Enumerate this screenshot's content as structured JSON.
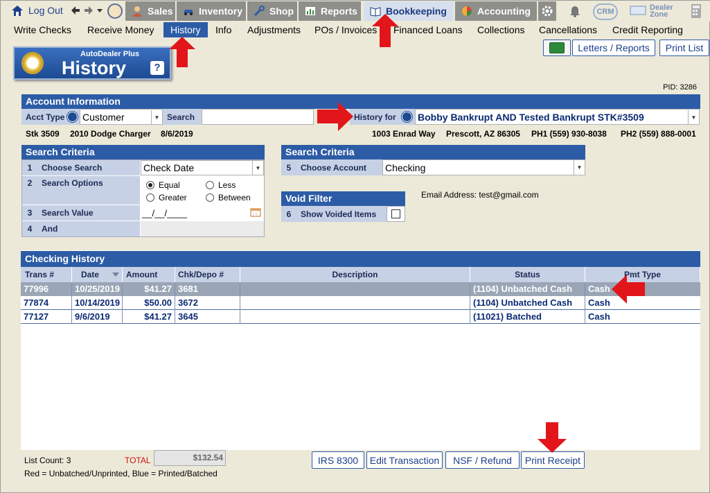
{
  "topnav": {
    "logout": "Log Out",
    "tabs": [
      {
        "label": "Sales",
        "icon": "person-icon"
      },
      {
        "label": "Inventory",
        "icon": "car-icon"
      },
      {
        "label": "Shop",
        "icon": "wrench-icon"
      },
      {
        "label": "Reports",
        "icon": "report-icon"
      },
      {
        "label": "Bookkeeping",
        "icon": "book-icon"
      },
      {
        "label": "Accounting",
        "icon": "pie-chart-icon"
      }
    ],
    "crm": "CRM",
    "dealer_zone": "Dealer Zone"
  },
  "subnav": {
    "items": [
      "Write Checks",
      "Receive Money",
      "History",
      "Info",
      "Adjustments",
      "POs / Invoices",
      "Financed Loans",
      "Collections",
      "Cancellations",
      "Credit Reporting"
    ],
    "active": "History"
  },
  "badge": {
    "brand": "AutoDealer Plus",
    "title": "History",
    "help": "?"
  },
  "actions": {
    "letters_reports": "Letters / Reports",
    "print_list": "Print List"
  },
  "pid": "PID: 3286",
  "account": {
    "header": "Account Information",
    "acct_type_label": "Acct Type",
    "acct_type_value": "Customer",
    "search_label": "Search",
    "search_value": "",
    "history_for_label": "History for",
    "history_for_value": "Bobby Bankrupt AND Tested Bankrupt STK#3509",
    "stk": "Stk 3509",
    "vehicle": "2010 Dodge Charger",
    "date": "8/6/2019",
    "address": "1003 Enrad Way",
    "city": "Prescott, AZ 86305",
    "ph1": "PH1 (559) 930-8038",
    "ph2": "PH2 (559) 888-0001"
  },
  "criteria_left": {
    "header": "Search Criteria",
    "rows": [
      {
        "num": "1",
        "label": "Choose Search",
        "value": "Check Date"
      },
      {
        "num": "2",
        "label": "Search Options"
      },
      {
        "num": "3",
        "label": "Search Value",
        "value": "__/__/____"
      },
      {
        "num": "4",
        "label": "And"
      }
    ],
    "options": [
      {
        "label": "Equal",
        "checked": true
      },
      {
        "label": "Less",
        "checked": false
      },
      {
        "label": "Greater",
        "checked": false
      },
      {
        "label": "Between",
        "checked": false
      }
    ]
  },
  "criteria_right": {
    "header": "Search Criteria",
    "num": "5",
    "label": "Choose Account",
    "value": "Checking",
    "email": "Email Address: test@gmail.com"
  },
  "void_filter": {
    "header": "Void Filter",
    "num": "6",
    "label": "Show Voided Items",
    "checked": false
  },
  "history": {
    "header": "Checking History",
    "columns": [
      "Trans #",
      "Date",
      "Amount",
      "Chk/Depo #",
      "Description",
      "Status",
      "Pmt Type"
    ],
    "rows": [
      {
        "trans": "77996",
        "date": "10/25/2019",
        "amount": "$41.27",
        "chk": "3681",
        "desc": "",
        "status": "(1104) Unbatched Cash",
        "type": "Cash",
        "selected": true
      },
      {
        "trans": "77874",
        "date": "10/14/2019",
        "amount": "$50.00",
        "chk": "3672",
        "desc": "",
        "status": "(1104) Unbatched Cash",
        "type": "Cash",
        "selected": false
      },
      {
        "trans": "77127",
        "date": "9/6/2019",
        "amount": "$41.27",
        "chk": "3645",
        "desc": "",
        "status": "(11021) Batched",
        "type": "Cash",
        "selected": false
      }
    ]
  },
  "footer": {
    "list_count": "List Count: 3",
    "total_label": "TOTAL",
    "total_value": "$132.54",
    "legend": "Red = Unbatched/Unprinted, Blue = Printed/Batched",
    "buttons": [
      "IRS 8300",
      "Edit Transaction",
      "NSF / Refund",
      "Print Receipt"
    ]
  },
  "colors": {
    "accent": "#2d5ca6",
    "label_bg": "#c6d1e5",
    "page_bg": "#ece9d8",
    "annotation_arrow": "#e2151b"
  }
}
